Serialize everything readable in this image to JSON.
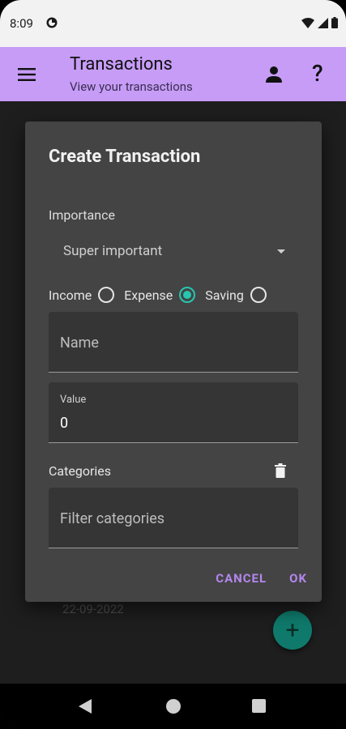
{
  "status": {
    "time": "8:09"
  },
  "appbar": {
    "title": "Transactions",
    "subtitle": "View your transactions"
  },
  "background": {
    "date": "22-09-2022",
    "fab_label": "+"
  },
  "dialog": {
    "title": "Create Transaction",
    "importance_label": "Importance",
    "importance_value": "Super important",
    "types": [
      {
        "label": "Income",
        "checked": false
      },
      {
        "label": "Expense",
        "checked": true
      },
      {
        "label": "Saving",
        "checked": false
      }
    ],
    "name_placeholder": "Name",
    "value_label": "Value",
    "value": "0",
    "categories_label": "Categories",
    "filter_placeholder": "Filter categories",
    "cancel_label": "CANCEL",
    "ok_label": "OK"
  },
  "colors": {
    "appbar": "#c79cf7",
    "accent_teal": "#26c6b0",
    "action_text": "#b487ee",
    "dialog_bg": "#444444"
  }
}
